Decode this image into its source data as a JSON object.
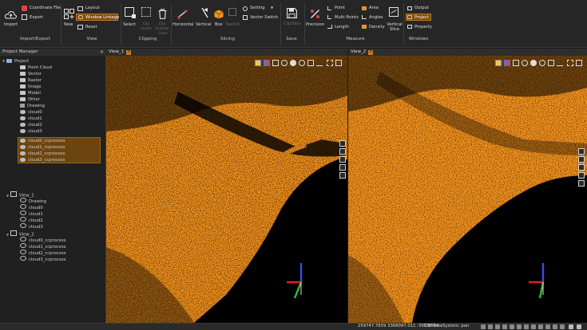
{
  "ribbon": {
    "import_export": {
      "title": "Import/Export",
      "import_label": "Import",
      "coordinate_file_label": "Coordinate File",
      "export_label": "Export"
    },
    "view": {
      "title": "View",
      "new_label": "New",
      "layout_label": "Layout",
      "window_linkage_label": "Window Linkage",
      "reset_label": "Reset"
    },
    "clipping": {
      "title": "Clipping",
      "select_label": "Select",
      "clip_inside_label": "Clip Inside",
      "clip_outside_label": "Clip Outside",
      "clear_label": "Clear"
    },
    "slicing": {
      "title": "Slicing",
      "horizontal_label": "Horizontal",
      "vertical_label": "Vertical",
      "box_label": "Box",
      "switch_label": "Switch",
      "setting_label": "Setting",
      "vector_switch_label": "Vector Switch"
    },
    "save": {
      "title": "Save",
      "clip_slice_label": "Clip/Slice"
    },
    "measure": {
      "title": "Measure",
      "precision_label": "Precision",
      "point_label": "Point",
      "multi_points_label": "Multi Points",
      "length_label": "Length",
      "area_label": "Area",
      "angles_label": "Angles",
      "density_label": "Density",
      "vertical_slice_label": "Vertical Slice"
    },
    "windows": {
      "title": "Windows",
      "output_label": "Output",
      "project_label": "Project",
      "property_label": "Property"
    }
  },
  "project_manager": {
    "title": "Project Manager",
    "project_tree": {
      "root": "Project",
      "folders": [
        "Point Cloud",
        "Vector",
        "Raster",
        "Image",
        "Model",
        "Other"
      ],
      "drawing": "Drawing",
      "clouds": [
        "cloud0",
        "cloud1",
        "cloud2",
        "cloud3"
      ],
      "processed": [
        "cloud0_ccprocess",
        "cloud1_ccprocess",
        "cloud2_ccprocess",
        "cloud3_ccprocess"
      ]
    },
    "view1_tree": {
      "root": "View_1",
      "items": [
        "Drawing",
        "cloud0",
        "cloud1",
        "cloud2",
        "cloud3"
      ]
    },
    "view2_tree": {
      "root": "View_2",
      "items": [
        "cloud0_ccprocess",
        "cloud1_ccprocess",
        "cloud2_ccprocess",
        "cloud3_ccprocess"
      ]
    }
  },
  "viewports": [
    {
      "tab_label": "View_1"
    },
    {
      "tab_label": "View_2"
    }
  ],
  "status_bar": {
    "coordinates": "259747.7659 3368097.011 -393.8554",
    "view_system": "CNcViewSystem: pan"
  },
  "colors": {
    "accent": "#c77a1e",
    "point_cloud": "#f7941d",
    "selection": "#6b4410",
    "background": "#000000",
    "axis_x": "#e02020",
    "axis_y": "#2fbf2f",
    "axis_z": "#3a4fe0"
  },
  "icons": {
    "import": "cloud-upload-icon",
    "coordinate_file": "coordinate-file-icon",
    "export": "export-icon",
    "new_view": "new-view-icon",
    "layout": "layout-icon",
    "window_linkage": "link-icon",
    "reset": "reset-icon",
    "select": "select-box-icon",
    "clear": "trash-icon",
    "horizontal": "horizontal-slice-icon",
    "vertical": "vertical-slice-icon",
    "box": "box-icon",
    "switch": "switch-icon",
    "setting": "gear-icon",
    "vector_switch": "vector-switch-icon",
    "save": "save-icon",
    "precision": "precision-icon",
    "vertical_slice": "vertical-slice-profile-icon"
  }
}
